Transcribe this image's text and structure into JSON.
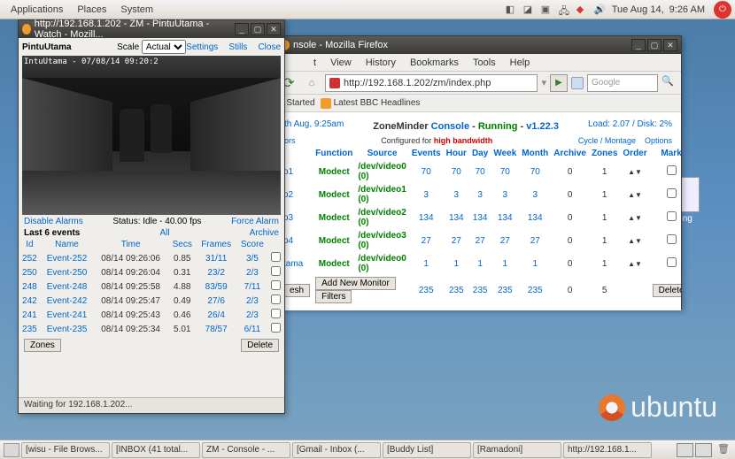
{
  "topbar": {
    "menus": [
      "Applications",
      "Places",
      "System"
    ],
    "day": "Tue Aug 14,",
    "time": "9:26 AM"
  },
  "taskbar": {
    "tasks": [
      "[wisu - File Brows...",
      "[INBOX (41 total...",
      "ZM - Console - ...",
      "[Gmail - Inbox (...",
      "[Buddy List]",
      "[Ramadoni]",
      "http://192.168.1..."
    ]
  },
  "desktop_icon": {
    "label": "v.png"
  },
  "watch_win": {
    "title": "http://192.168.1.202 - ZM - PintuUtama - Watch - Mozill...",
    "name": "PintuUtama",
    "scale_label": "Scale",
    "scale_value": "Actual",
    "link_settings": "Settings",
    "link_stills": "Stills",
    "link_close": "Close",
    "video_ts": "IntuUtama - 07/08/14 09:20:2",
    "disable_alarms": "Disable Alarms",
    "status": "Status: Idle - 40.00 fps",
    "force_alarm": "Force Alarm",
    "last_events": "Last 6 events",
    "all": "All",
    "archive": "Archive",
    "cols": [
      "Id",
      "Name",
      "Time",
      "Secs",
      "Frames",
      "Score",
      ""
    ],
    "rows": [
      {
        "id": "252",
        "name": "Event-252",
        "time": "08/14 09:26:06",
        "secs": "0.85",
        "frames": "31/11",
        "score": "3/5"
      },
      {
        "id": "250",
        "name": "Event-250",
        "time": "08/14 09:26:04",
        "secs": "0.31",
        "frames": "23/2",
        "score": "2/3"
      },
      {
        "id": "248",
        "name": "Event-248",
        "time": "08/14 09:25:58",
        "secs": "4.88",
        "frames": "83/59",
        "score": "7/11"
      },
      {
        "id": "242",
        "name": "Event-242",
        "time": "08/14 09:25:47",
        "secs": "0.49",
        "frames": "27/6",
        "score": "2/3"
      },
      {
        "id": "241",
        "name": "Event-241",
        "time": "08/14 09:25:43",
        "secs": "0.46",
        "frames": "26/4",
        "score": "2/3"
      },
      {
        "id": "235",
        "name": "Event-235",
        "time": "08/14 09:25:34",
        "secs": "5.01",
        "frames": "78/57",
        "score": "6/11"
      }
    ],
    "zones_btn": "Zones",
    "delete_btn": "Delete",
    "statusbar": "Waiting for 192.168.1.202..."
  },
  "fx_win": {
    "title": "nsole - Mozilla Firefox",
    "menus": [
      "t",
      "View",
      "History",
      "Bookmarks",
      "Tools",
      "Help"
    ],
    "url": "http://192.168.1.202/zm/index.php",
    "search_ph": "Google",
    "bm1": "g Started",
    "bm2": "Latest BBC Headlines",
    "head_time": "th Aug, 9:25am",
    "head_load": "Load: 2.07 / Disk: 2%",
    "zm_label": "ZoneMinder",
    "console_label": "Console",
    "running": "Running",
    "version": "v1.22.3",
    "cfg_prefix": "Configured for",
    "cfg_bw": "high bandwidth",
    "ors": "ors",
    "cycle_montage": "Cycle / Montage",
    "options": "Options",
    "cols": [
      "",
      "Function",
      "Source",
      "Events",
      "Hour",
      "Day",
      "Week",
      "Month",
      "Archive",
      "Zones",
      "Order",
      "Mark"
    ],
    "rows": [
      {
        "n": "o1",
        "f": "Modect",
        "s": "/dev/video0 (0)",
        "e": "70",
        "h": "70",
        "d": "70",
        "w": "70",
        "m": "70",
        "a": "0",
        "z": "1"
      },
      {
        "n": "o2",
        "f": "Modect",
        "s": "/dev/video1 (0)",
        "e": "3",
        "h": "3",
        "d": "3",
        "w": "3",
        "m": "3",
        "a": "0",
        "z": "1"
      },
      {
        "n": "o3",
        "f": "Modect",
        "s": "/dev/video2 (0)",
        "e": "134",
        "h": "134",
        "d": "134",
        "w": "134",
        "m": "134",
        "a": "0",
        "z": "1"
      },
      {
        "n": "o4",
        "f": "Modect",
        "s": "/dev/video3 (0)",
        "e": "27",
        "h": "27",
        "d": "27",
        "w": "27",
        "m": "27",
        "a": "0",
        "z": "1"
      },
      {
        "n": "tama",
        "f": "Modect",
        "s": "/dev/video0 (0)",
        "e": "1",
        "h": "1",
        "d": "1",
        "w": "1",
        "m": "1",
        "a": "0",
        "z": "1"
      }
    ],
    "totals": {
      "e": "235",
      "h": "235",
      "d": "235",
      "w": "235",
      "m": "235",
      "a": "0",
      "z": "5"
    },
    "esh_btn": "esh",
    "add_btn": "Add New Monitor",
    "filters_btn": "Filters",
    "delete_btn": "Delete"
  },
  "ubuntu": "ubuntu"
}
